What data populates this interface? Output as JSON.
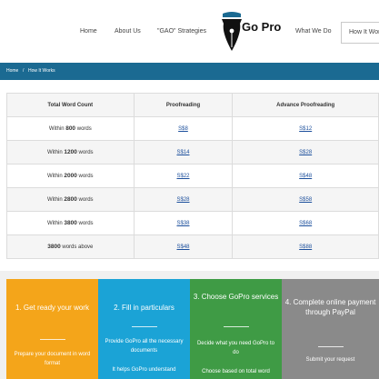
{
  "nav": {
    "home": "Home",
    "about": "About Us",
    "gao": "\"GAO\" Strategies",
    "logo_text": "Go Pro",
    "whatwedo": "What We Do",
    "howitworks": "How It Wor"
  },
  "breadcrumb": {
    "home": "Home",
    "sep": "/",
    "current": "How It Works"
  },
  "table": {
    "headers": [
      "Total Word Count",
      "Proofreading",
      "Advance Proofreading"
    ],
    "rows": [
      {
        "prefix": "Within",
        "count": "800",
        "suffix": "words",
        "proof": "S$8",
        "advance": "S$12"
      },
      {
        "prefix": "Within",
        "count": "1200",
        "suffix": "words",
        "proof": "S$14",
        "advance": "S$28"
      },
      {
        "prefix": "Within",
        "count": "2000",
        "suffix": "words",
        "proof": "S$22",
        "advance": "S$48"
      },
      {
        "prefix": "Within",
        "count": "2800",
        "suffix": "words",
        "proof": "S$28",
        "advance": "S$58"
      },
      {
        "prefix": "Within",
        "count": "3800",
        "suffix": "words",
        "proof": "S$38",
        "advance": "S$68"
      },
      {
        "prefix": "",
        "count": "3800",
        "suffix": "words above",
        "proof": "S$48",
        "advance": "S$88"
      }
    ]
  },
  "steps": [
    {
      "title": "1. Get ready your work",
      "text1": "Prepare your document in word format",
      "text2": ""
    },
    {
      "title": "2. Fill in particulars",
      "text1": "Provide GoPro all the necessary documents",
      "text2": "It helps GoPro understand"
    },
    {
      "title": "3. Choose GoPro services",
      "text1": "Decide what you need GoPro to do",
      "text2": "Choose based on total word"
    },
    {
      "title": "4. Complete online payment through PayPal",
      "text1": "Submit your request",
      "text2": ""
    }
  ],
  "colors": {
    "crumb_bar": "#1b6a92",
    "step1": "#f4a51a",
    "step2": "#1ba3d6",
    "step3": "#3f9b45",
    "step4": "#8a8a8a",
    "link": "#1c4f9c"
  }
}
